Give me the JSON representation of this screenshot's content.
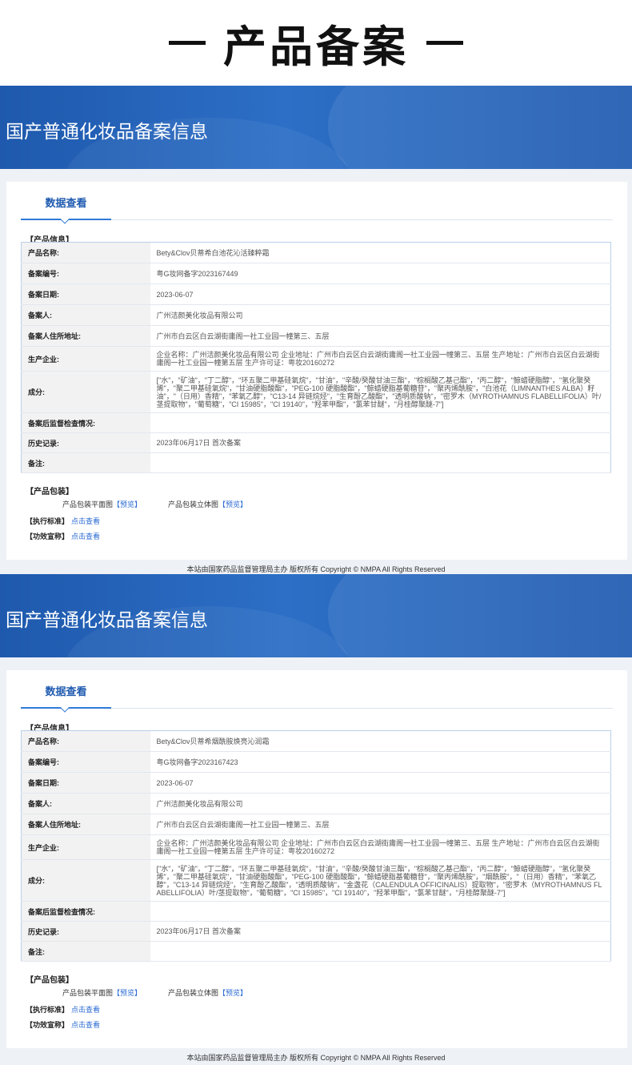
{
  "page_title": "产品备案",
  "sections": [
    {
      "banner_title": "国产普通化妆品备案信息",
      "tab": "数据查看",
      "product_info_label": "【产品信息】",
      "rows": [
        {
          "key": "产品名称:",
          "value": "Bety&Clov贝蒂希白池花沁活臻粹霜"
        },
        {
          "key": "备案编号:",
          "value": "粤G妆网备字2023167449"
        },
        {
          "key": "备案日期:",
          "value": "2023-06-07"
        },
        {
          "key": "备案人:",
          "value": "广州洁颜美化妆品有限公司"
        },
        {
          "key": "备案人住所地址:",
          "value": "广州市白云区白云湖街庸阁一社工业园一幢第三、五层"
        },
        {
          "key": "生产企业:",
          "value": "企业名称：广州洁颜美化妆品有限公司 企业地址：广州市白云区白云湖街庸阁一社工业园一幢第三、五层 生产地址：广州市白云区白云湖街庸阁一社工业园一幢第五层 生产许可证：粤妆20160272"
        },
        {
          "key": "成分:",
          "value": "[\"水\"，\"矿油\"，\"丁二醇\"，\"环五聚二甲基硅氧烷\"，\"甘油\"，\"辛酸/癸酸甘油三酯\"，\"棕榈酸乙基己酯\"，\"丙二醇\"，\"鲸蜡硬脂醇\"，\"氢化聚癸烯\"，\"聚二甲基硅氧烷\"，\"甘油硬脂酸酯\"，\"PEG-100 硬脂酸酯\"，\"鲸蜡硬脂基葡糖苷\"，\"聚丙烯酰胺\"，\"白池花（LIMNANTHES ALBA）籽油\"，\"（日用）香精\"，\"苯氧乙醇\"，\"C13-14 异链烷烃\"，\"生育酚乙酸酯\"，\"透明质酸钠\"，\"密罗木（MYROTHAMNUS FLABELLIFOLIA）叶/茎提取物\"，\"葡萄糖\"，\"CI 15985\"，\"CI 19140\"，\"羟苯甲酯\"，\"氯苯甘醚\"，\"月桂醇聚醚-7\"]"
        },
        {
          "key": "备案后监督检查情况:",
          "value": ""
        },
        {
          "key": "历史记录:",
          "value": "2023年06月17日 首次备案"
        },
        {
          "key": "备注:",
          "value": ""
        }
      ],
      "packaging_label": "【产品包装】",
      "pack_flat": "产品包装平面图",
      "pack_3d": "产品包装立体图",
      "preview_link": "【预览】",
      "standard_label": "【执行标准】",
      "efficacy_label": "【功效宣称】",
      "view_link": "点击查看",
      "footer": "本站由国家药品监督管理局主办 版权所有 Copyright © NMPA All Rights Reserved"
    },
    {
      "banner_title": "国产普通化妆品备案信息",
      "tab": "数据查看",
      "product_info_label": "【产品信息】",
      "rows": [
        {
          "key": "产品名称:",
          "value": "Bety&Clov贝蒂希烟酰胺焕亮沁润霜"
        },
        {
          "key": "备案编号:",
          "value": "粤G妆网备字2023167423"
        },
        {
          "key": "备案日期:",
          "value": "2023-06-07"
        },
        {
          "key": "备案人:",
          "value": "广州洁颜美化妆品有限公司"
        },
        {
          "key": "备案人住所地址:",
          "value": "广州市白云区白云湖街庸阁一社工业园一幢第三、五层"
        },
        {
          "key": "生产企业:",
          "value": "企业名称：广州洁颜美化妆品有限公司 企业地址：广州市白云区白云湖街庸阁一社工业园一幢第三、五层 生产地址：广州市白云区白云湖街庸阁一社工业园一幢第五层 生产许可证：粤妆20160272"
        },
        {
          "key": "成分:",
          "value": "[\"水\"，\"矿油\"，\"丁二醇\"，\"环五聚二甲基硅氧烷\"，\"甘油\"，\"辛酸/癸酸甘油三酯\"，\"棕榈酸乙基己酯\"，\"丙二醇\"，\"鲸蜡硬脂醇\"，\"氢化聚癸烯\"，\"聚二甲基硅氧烷\"，\"甘油硬脂酸酯\"，\"PEG-100 硬脂酸酯\"，\"鲸蜡硬脂基葡糖苷\"，\"聚丙烯酰胺\"，\"烟酰胺\"，\"（日用）香精\"，\"苯氧乙醇\"，\"C13-14 异链烷烃\"，\"生育酚乙酸酯\"，\"透明质酸钠\"，\"金盏花（CALENDULA OFFICINALIS）提取物\"，\"密罗木（MYROTHAMNUS FLABELLIFOLIA）叶/茎提取物\"，\"葡萄糖\"，\"CI 15985\"，\"CI 19140\"，\"羟苯甲酯\"，\"氯苯甘醚\"，\"月桂醇聚醚-7\"]"
        },
        {
          "key": "备案后监督检查情况:",
          "value": ""
        },
        {
          "key": "历史记录:",
          "value": "2023年06月17日 首次备案"
        },
        {
          "key": "备注:",
          "value": ""
        }
      ],
      "packaging_label": "【产品包装】",
      "pack_flat": "产品包装平面图",
      "pack_3d": "产品包装立体图",
      "preview_link": "【预览】",
      "standard_label": "【执行标准】",
      "efficacy_label": "【功效宣称】",
      "view_link": "点击查看",
      "footer": "本站由国家药品监督管理局主办 版权所有 Copyright © NMPA All Rights Reserved"
    }
  ]
}
